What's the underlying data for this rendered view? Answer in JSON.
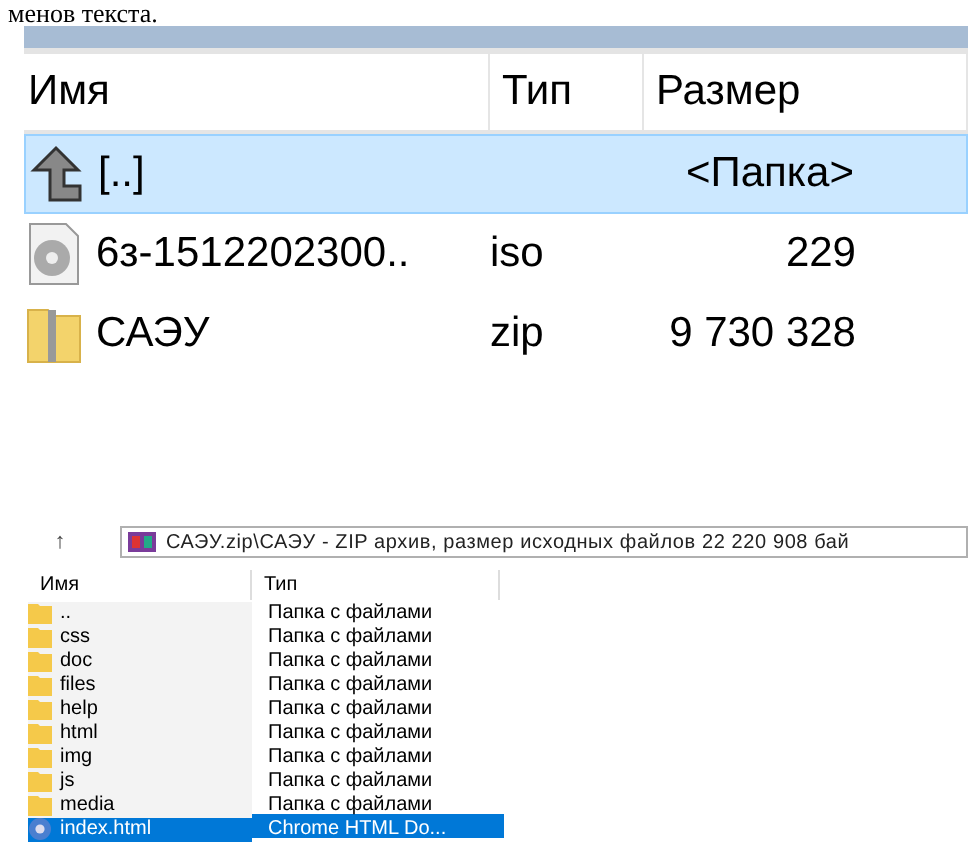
{
  "caption": "менов текста.",
  "file_panel": {
    "columns": [
      "Имя",
      "Тип",
      "Размер"
    ],
    "rows": [
      {
        "kind": "up",
        "name": "[..]",
        "size": "<Папка>",
        "selected": true
      },
      {
        "kind": "disc",
        "name": "6з-1512202300..",
        "type": "iso",
        "size": "229",
        "selected": false
      },
      {
        "kind": "zip",
        "name": "САЭУ",
        "type": "zip",
        "size": "9 730 328",
        "selected": false
      }
    ]
  },
  "archive_window": {
    "up_button": "↑",
    "path": "САЭУ.zip\\САЭУ - ZIP архив, размер исходных файлов 22 220 908 бай",
    "columns": [
      "Имя",
      "Тип"
    ],
    "rows": [
      {
        "kind": "folder",
        "name": "..",
        "type": "Папка с файлами",
        "selected": false
      },
      {
        "kind": "folder",
        "name": "css",
        "type": "Папка с файлами",
        "selected": false
      },
      {
        "kind": "folder",
        "name": "doc",
        "type": "Папка с файлами",
        "selected": false
      },
      {
        "kind": "folder",
        "name": "files",
        "type": "Папка с файлами",
        "selected": false
      },
      {
        "kind": "folder",
        "name": "help",
        "type": "Папка с файлами",
        "selected": false
      },
      {
        "kind": "folder",
        "name": "html",
        "type": "Папка с файлами",
        "selected": false
      },
      {
        "kind": "folder",
        "name": "img",
        "type": "Папка с файлами",
        "selected": false
      },
      {
        "kind": "folder",
        "name": "js",
        "type": "Папка с файлами",
        "selected": false
      },
      {
        "kind": "folder",
        "name": "media",
        "type": "Папка с файлами",
        "selected": false
      },
      {
        "kind": "html",
        "name": "index.html",
        "type": "Chrome HTML Do...",
        "selected": true
      }
    ]
  }
}
